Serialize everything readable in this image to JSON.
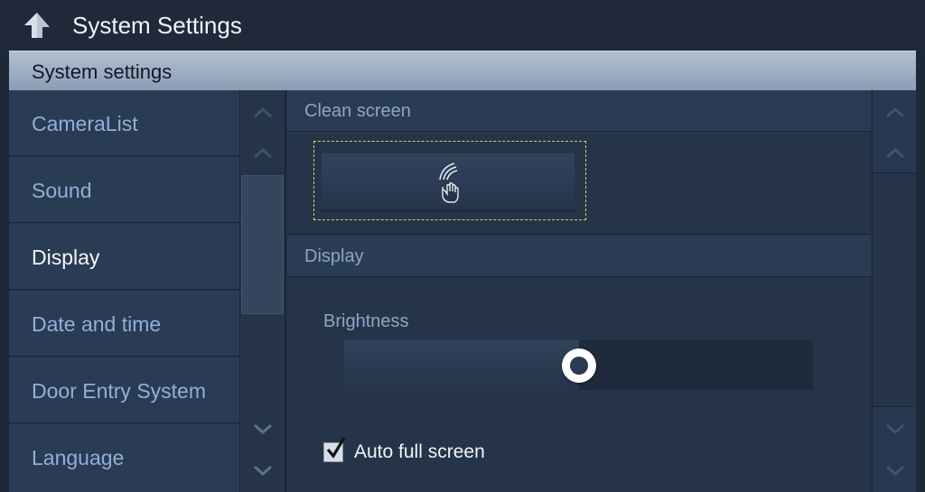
{
  "header": {
    "title": "System Settings",
    "back_icon": "back-arrow-icon"
  },
  "section": {
    "title": "System settings"
  },
  "menu": {
    "items": [
      {
        "label": "CameraList"
      },
      {
        "label": "Sound"
      },
      {
        "label": "Display",
        "active": true
      },
      {
        "label": "Date and time"
      },
      {
        "label": "Door Entry System"
      },
      {
        "label": "Language"
      }
    ]
  },
  "content": {
    "clean_screen": {
      "title": "Clean screen",
      "button_icon": "hand-wipe-icon"
    },
    "display": {
      "title": "Display",
      "brightness_label": "Brightness",
      "brightness_value": 0.5,
      "auto_full_screen_label": "Auto full screen",
      "auto_full_screen_checked": true
    }
  },
  "colors": {
    "accent_outline": "#d8d84a",
    "active_text": "#f4f6f9",
    "inactive_text": "#8fb1d6"
  }
}
